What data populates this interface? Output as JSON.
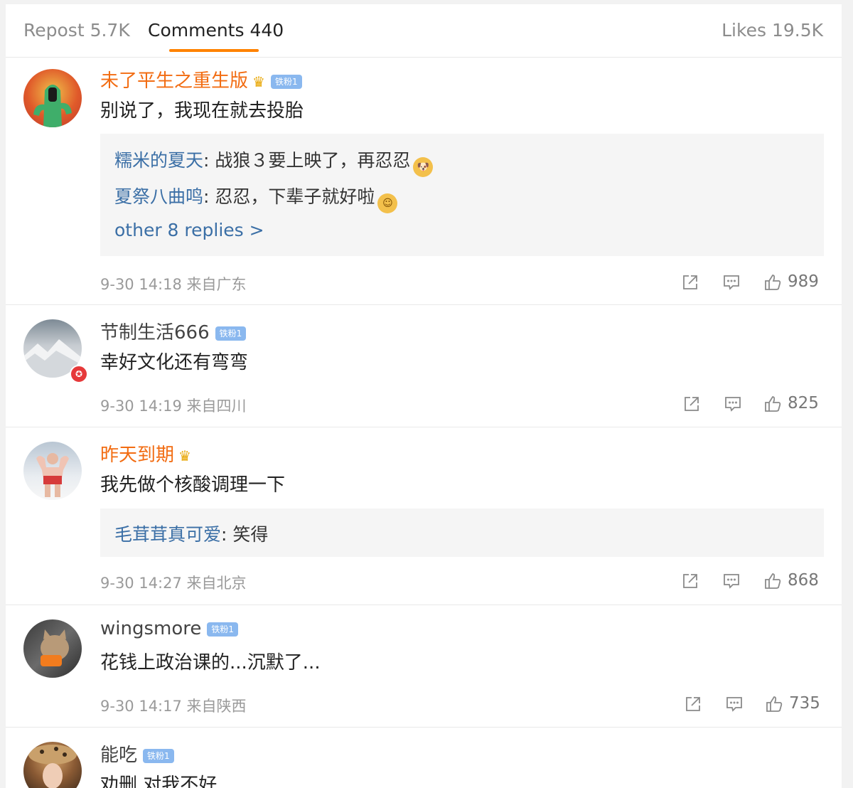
{
  "tabs": {
    "repost": "Repost 5.7K",
    "comments": "Comments 440",
    "likes": "Likes 19.5K"
  },
  "colors": {
    "accent": "#ff8200",
    "username_vip": "#f26c12",
    "reply_name": "#3b6fa6"
  },
  "comments": [
    {
      "user": "未了平生之重生版",
      "fan_badge": "铁粉1",
      "text": "别说了，我现在就去投胎",
      "replies": [
        {
          "user": "糯米的夏天",
          "sep": ":",
          "text": " 战狼３要上映了，再忍忍",
          "emoji": "doge"
        },
        {
          "user": "夏祭八曲鸣",
          "sep": ":",
          "text": " 忍忍，下辈子就好啦",
          "emoji": "smile"
        }
      ],
      "more": "other 8 replies >",
      "time": "9-30 14:18 来自广东",
      "likes": "989"
    },
    {
      "user": "节制生活666",
      "fan_badge": "铁粉1",
      "text": "幸好文化还有弯弯",
      "time": "9-30 14:19 来自四川",
      "likes": "825"
    },
    {
      "user": "昨天到期",
      "text": "我先做个核酸调理一下",
      "replies": [
        {
          "user": "毛茸茸真可爱",
          "sep": ":",
          "text": " 笑得"
        }
      ],
      "time": "9-30 14:27 来自北京",
      "likes": "868"
    },
    {
      "user": "wingsmore",
      "fan_badge": "铁粉1",
      "text": "花钱上政治课的...沉默了...",
      "time": "9-30 14:17 来自陕西",
      "likes": "735"
    },
    {
      "user": "能吃",
      "fan_badge": "铁粉1",
      "text": "劝删 对我不好"
    }
  ]
}
